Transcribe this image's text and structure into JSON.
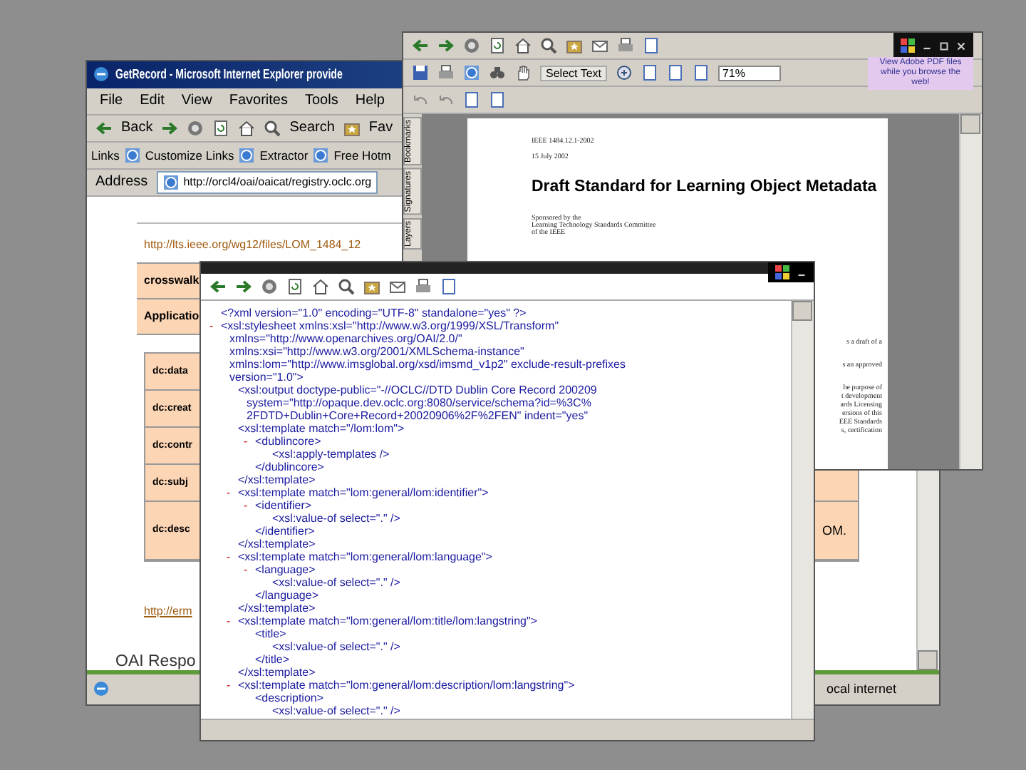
{
  "ie_window": {
    "title": "GetRecord - Microsoft Internet Explorer provide",
    "menu": [
      "File",
      "Edit",
      "View",
      "Favorites",
      "Tools",
      "Help"
    ],
    "toolbar": {
      "back": "Back",
      "search": "Search",
      "favorites": "Fav"
    },
    "links": {
      "label": "Links",
      "items": [
        "Customize Links",
        "Extractor",
        "Free Hotm"
      ]
    },
    "address": {
      "label": "Address",
      "value": "http://orcl4/oai/oaicat/registry.oclc.org"
    },
    "page": {
      "top_link": "http://lts.ieee.org/wg12/files/LOM_1484_12",
      "table_1": [
        "crosswalk",
        "Applicatio"
      ],
      "table_2": [
        "dc:data",
        "dc:creat",
        "dc:contr",
        "dc:subj",
        "dc:desc"
      ],
      "side_cell": "OM.",
      "bottom_link": "http://erm",
      "response_heading": "OAI Respo"
    },
    "status_bar": "ocal internet"
  },
  "pdf_window": {
    "select_tool": "Select Text",
    "zoom": "71%",
    "promo": "View Adobe PDF files while you browse the web!",
    "side_tabs": [
      "Bookmarks",
      "Signatures",
      "Layers"
    ],
    "document": {
      "designation": "IEEE 1484.12.1-2002",
      "date": "15 July 2002",
      "title": "Draft Standard for Learning Object Metadata",
      "sponsor": [
        "Sponsored by the",
        "Learning Technology Standards Committee",
        "of the IEEE"
      ],
      "fragments": [
        "s a draft of a",
        "s an approved",
        "he purpose of",
        "t development",
        "ards Licensing",
        "ersions of this",
        "EEE Standards",
        "s, certification"
      ]
    }
  },
  "xml_window": {
    "nodes": [
      {
        "lines": [
          "<?xml version=\"1.0\" encoding=\"UTF-8\" standalone=\"yes\" ?>"
        ]
      },
      {
        "toggle": "-",
        "lines": [
          "<xsl:stylesheet xmlns:xsl=\"http://www.w3.org/1999/XSL/Transform\"",
          "xmlns=\"http://www.openarchives.org/OAI/2.0/\"",
          "xmlns:xsi=\"http://www.w3.org/2001/XMLSchema-instance\"",
          "xmlns:lom=\"http://www.imsglobal.org/xsd/imsmd_v1p2\" exclude-result-prefixes",
          "version=\"1.0\">"
        ],
        "children": [
          {
            "lines": [
              "<xsl:output doctype-public=\"-//OCLC//DTD Dublin Core Record 200209",
              "system=\"http://opaque.dev.oclc.org:8080/service/schema?id=%3C%",
              "2FDTD+Dublin+Core+Record+20020906%2F%2FEN\" indent=\"yes\""
            ]
          },
          {
            "lines": [
              "<xsl:template match=\"/lom:lom\">"
            ],
            "children": [
              {
                "toggle": "-",
                "lines": [
                  "<dublincore>"
                ],
                "children": [
                  {
                    "lines": [
                      "<xsl:apply-templates />"
                    ]
                  }
                ],
                "close": "</dublincore>"
              }
            ],
            "close": "</xsl:template>"
          },
          {
            "toggle": "-",
            "lines": [
              "<xsl:template match=\"lom:general/lom:identifier\">"
            ],
            "children": [
              {
                "toggle": "-",
                "lines": [
                  "<identifier>"
                ],
                "children": [
                  {
                    "lines": [
                      "<xsl:value-of select=\".\" />"
                    ]
                  }
                ],
                "close": "</identifier>"
              }
            ],
            "close": "</xsl:template>"
          },
          {
            "toggle": "-",
            "lines": [
              "<xsl:template match=\"lom:general/lom:language\">"
            ],
            "children": [
              {
                "toggle": "-",
                "lines": [
                  "<language>"
                ],
                "children": [
                  {
                    "lines": [
                      "<xsl:value-of select=\".\" />"
                    ]
                  }
                ],
                "close": "</language>"
              }
            ],
            "close": "</xsl:template>"
          },
          {
            "toggle": "-",
            "lines": [
              "<xsl:template match=\"lom:general/lom:title/lom:langstring\">"
            ],
            "children": [
              {
                "lines": [
                  "<title>"
                ],
                "children": [
                  {
                    "lines": [
                      "<xsl:value-of select=\".\" />"
                    ]
                  }
                ],
                "close": "</title>"
              }
            ],
            "close": "</xsl:template>"
          },
          {
            "toggle": "-",
            "lines": [
              "<xsl:template match=\"lom:general/lom:description/lom:langstring\">"
            ],
            "children": [
              {
                "lines": [
                  "<description>"
                ],
                "children": [
                  {
                    "lines": [
                      "<xsl:value-of select=\".\" />"
                    ]
                  }
                ]
              }
            ]
          }
        ]
      }
    ]
  }
}
